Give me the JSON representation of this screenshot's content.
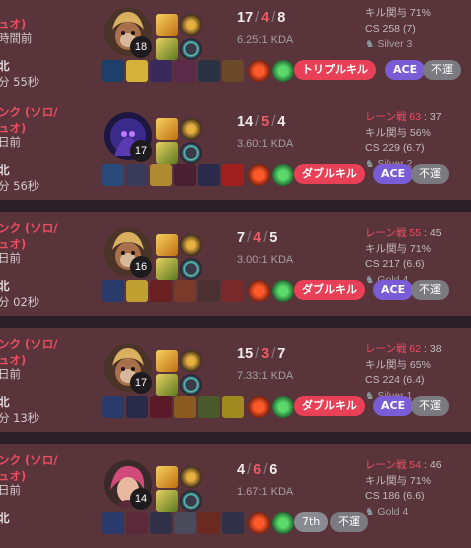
{
  "games": [
    {
      "queue_line1": "",
      "queue_line2": "ュオ)",
      "time_ago": "時間前",
      "result": "北",
      "duration": "分 55秒",
      "champion_icon": "wukong-portrait",
      "level": "18",
      "kills": "17",
      "deaths": "4",
      "assists": "8",
      "kda_ratio": "6.25:1 KDA",
      "lane_label": "",
      "lane_num": "",
      "lane_rest": "",
      "kill_participation": "キル関与 71%",
      "cs": "CS 258 (7)",
      "tier": "Silver 3",
      "badges": [
        "トリプルキル",
        "ACE",
        "不運"
      ]
    },
    {
      "queue_line1": "ンク (ソロ/",
      "queue_line2": "ュオ)",
      "time_ago": "日前",
      "result": "北",
      "duration": "分 56秒",
      "champion_icon": "kassadin-portrait",
      "level": "17",
      "kills": "14",
      "deaths": "5",
      "assists": "4",
      "kda_ratio": "3.60:1 KDA",
      "lane_label": "レーン戦",
      "lane_num": "63",
      "lane_rest": ": 37",
      "kill_participation": "キル関与 56%",
      "cs": "CS 229 (6.7)",
      "tier": "Silver 2",
      "badges": [
        "ダブルキル",
        "ACE",
        "不運"
      ]
    },
    {
      "queue_line1": "ンク (ソロ/",
      "queue_line2": "ュオ)",
      "time_ago": "日前",
      "result": "北",
      "duration": "分 02秒",
      "champion_icon": "wukong-portrait",
      "level": "16",
      "kills": "7",
      "deaths": "4",
      "assists": "5",
      "kda_ratio": "3.00:1 KDA",
      "lane_label": "レーン戦",
      "lane_num": "55",
      "lane_rest": ": 45",
      "kill_participation": "キル関与 71%",
      "cs": "CS 217 (6.6)",
      "tier": "Gold 4",
      "badges": [
        "ダブルキル",
        "ACE",
        "不運"
      ]
    },
    {
      "queue_line1": "ンク (ソロ/",
      "queue_line2": "ュオ)",
      "time_ago": "日前",
      "result": "北",
      "duration": "分 13秒",
      "champion_icon": "wukong-portrait",
      "level": "17",
      "kills": "15",
      "deaths": "3",
      "assists": "7",
      "kda_ratio": "7.33:1 KDA",
      "lane_label": "レーン戦",
      "lane_num": "62",
      "lane_rest": ": 38",
      "kill_participation": "キル関与 65%",
      "cs": "CS 224 (6.4)",
      "tier": "Silver 1",
      "badges": [
        "ダブルキル",
        "ACE",
        "不運"
      ]
    },
    {
      "queue_line1": "ンク (ソロ/",
      "queue_line2": "ュオ)",
      "time_ago": "日前",
      "result": "北",
      "duration": "",
      "champion_icon": "vi-portrait",
      "level": "14",
      "kills": "4",
      "deaths": "6",
      "assists": "6",
      "kda_ratio": "1.67:1 KDA",
      "lane_label": "レーン戦",
      "lane_num": "54",
      "lane_rest": ": 46",
      "kill_participation": "キル関与 71%",
      "cs": "CS 186 (6.6)",
      "tier": "Gold 4",
      "badges": [
        "7th",
        "不運"
      ]
    }
  ],
  "colors": {
    "card_bg": "#59343b",
    "loss_red": "#ef4c64",
    "multikill": "#e84057",
    "ace": "#7a5cd7",
    "bad_luck": "#7b7a80"
  }
}
